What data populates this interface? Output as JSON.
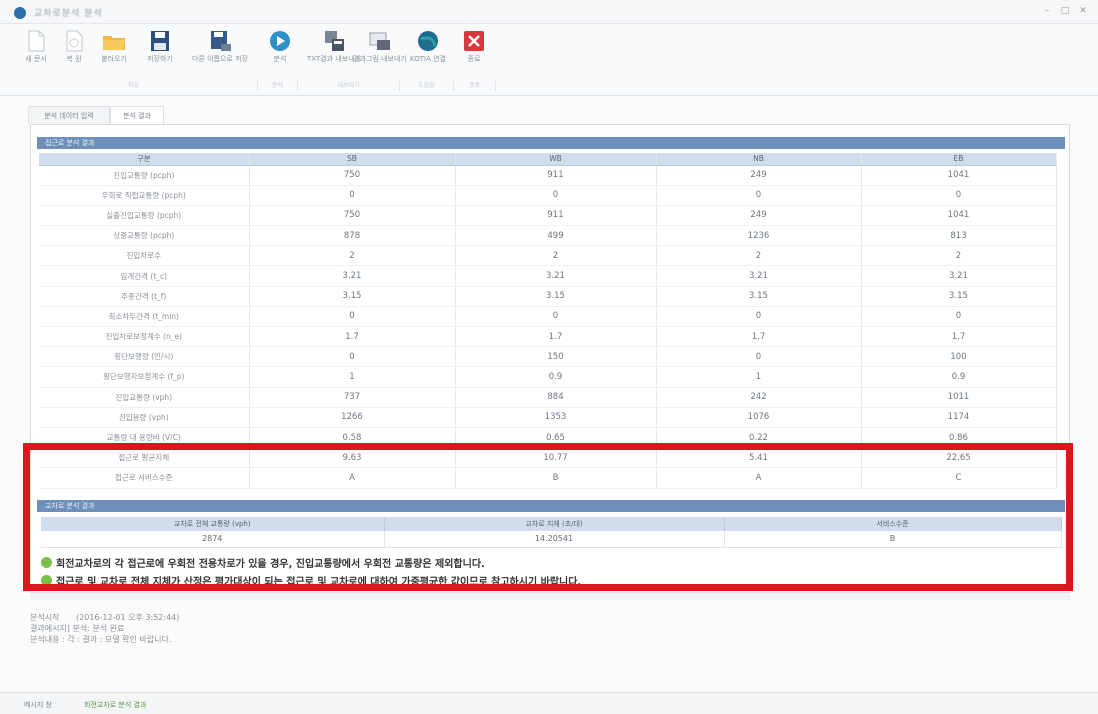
{
  "window": {
    "title": "교차로분석 분석"
  },
  "toolbar": {
    "buttons": [
      {
        "label": "새 문서",
        "icon": "new-doc-icon"
      },
      {
        "label": "복 원",
        "icon": "restore-icon"
      },
      {
        "label": "불러오기",
        "icon": "open-folder-icon"
      },
      {
        "label": "저장하기",
        "icon": "save-icon"
      },
      {
        "label": "다른 이름으로 저장",
        "icon": "save-as-icon"
      },
      {
        "label": "분석",
        "icon": "play-icon"
      },
      {
        "label": "TXT결과 내보내기",
        "icon": "txt-export-icon"
      },
      {
        "label": "결과그림 내보내기",
        "icon": "image-export-icon"
      },
      {
        "label": "KOTIA 연결",
        "icon": "globe-icon"
      },
      {
        "label": "종료",
        "icon": "close-icon"
      }
    ],
    "groups": [
      "파일",
      "분석",
      "내보내기",
      "도움말",
      "종료"
    ]
  },
  "tabs": [
    {
      "label": "분석 데이터 입력"
    },
    {
      "label": "분석 결과"
    }
  ],
  "approach_section": {
    "title": "접근로 분석 결과",
    "columns": [
      "구분",
      "SB",
      "WB",
      "NB",
      "EB"
    ],
    "rows": [
      {
        "label": "진입교통량 (pcph)",
        "values": [
          "750",
          "911",
          "249",
          "1041"
        ]
      },
      {
        "label": "우회로 직접교통량 (pcph)",
        "values": [
          "0",
          "0",
          "0",
          "0"
        ]
      },
      {
        "label": "실출진입교통량 (pcph)",
        "values": [
          "750",
          "911",
          "249",
          "1041"
        ]
      },
      {
        "label": "상충교통량 (pcph)",
        "values": [
          "878",
          "499",
          "1236",
          "813"
        ]
      },
      {
        "label": "진입차로수",
        "values": [
          "2",
          "2",
          "2",
          "2"
        ]
      },
      {
        "label": "임계간격 (t_c)",
        "values": [
          "3.21",
          "3.21",
          "3.21",
          "3.21"
        ]
      },
      {
        "label": "추종간격 (t_f)",
        "values": [
          "3.15",
          "3.15",
          "3.15",
          "3.15"
        ]
      },
      {
        "label": "최소차두간격 (t_min)",
        "values": [
          "0",
          "0",
          "0",
          "0"
        ]
      },
      {
        "label": "진입차로보정계수 (n_e)",
        "values": [
          "1.7",
          "1.7",
          "1.7",
          "1.7"
        ]
      },
      {
        "label": "횡단보행량 (인/시)",
        "values": [
          "0",
          "150",
          "0",
          "100"
        ]
      },
      {
        "label": "횡단보행자보정계수 (f_p)",
        "values": [
          "1",
          "0.9",
          "1",
          "0.9"
        ]
      },
      {
        "label": "진입교통량 (vph)",
        "values": [
          "737",
          "884",
          "242",
          "1011"
        ]
      },
      {
        "label": "진입용량 (vph)",
        "values": [
          "1266",
          "1353",
          "1076",
          "1174"
        ]
      },
      {
        "label": "교통량 대 용량비 (V/C)",
        "values": [
          "0.58",
          "0.65",
          "0.22",
          "0.86"
        ]
      },
      {
        "label": "접근로 평균지체",
        "values": [
          "9.63",
          "10.77",
          "5.41",
          "22.65"
        ]
      },
      {
        "label": "접근로 서비스수준",
        "values": [
          "A",
          "B",
          "A",
          "C"
        ]
      }
    ]
  },
  "intersection_section": {
    "title": "교차로 분석 결과",
    "columns": [
      "교차로 전체 교통량 (vph)",
      "교차로 지체 (초/대)",
      "서비스수준"
    ],
    "values": [
      "2874",
      "14.20541",
      "B"
    ]
  },
  "notes": [
    "회전교차로의 각 접근로에 우회전 전용차로가 있을 경우, 진입교통량에서 우회전 교통량은 제외합니다.",
    "접근로 및 교차로 전체 지체가 산정은 평가대상이 되는 접근로 및 교차로에 대하여 가중평균한 값이므로 참고하시기 바랍니다."
  ],
  "log": {
    "label": "분석시작",
    "timestamp": "(2016-12-01 오후 3:52:44)",
    "lines": [
      "결과메시지] 분석: 분석 완료",
      "분석내용 : 각 : 결과 : 모델 확인 바랍니다."
    ]
  },
  "statusbar": {
    "tabs": [
      "메시지 창",
      "회전교차로 분석 결과"
    ]
  },
  "colors": {
    "highlight": "#e1131c",
    "header": "#6d8fb9",
    "table_header": "#cfdcec",
    "note_bullet": "#7cc04a"
  }
}
